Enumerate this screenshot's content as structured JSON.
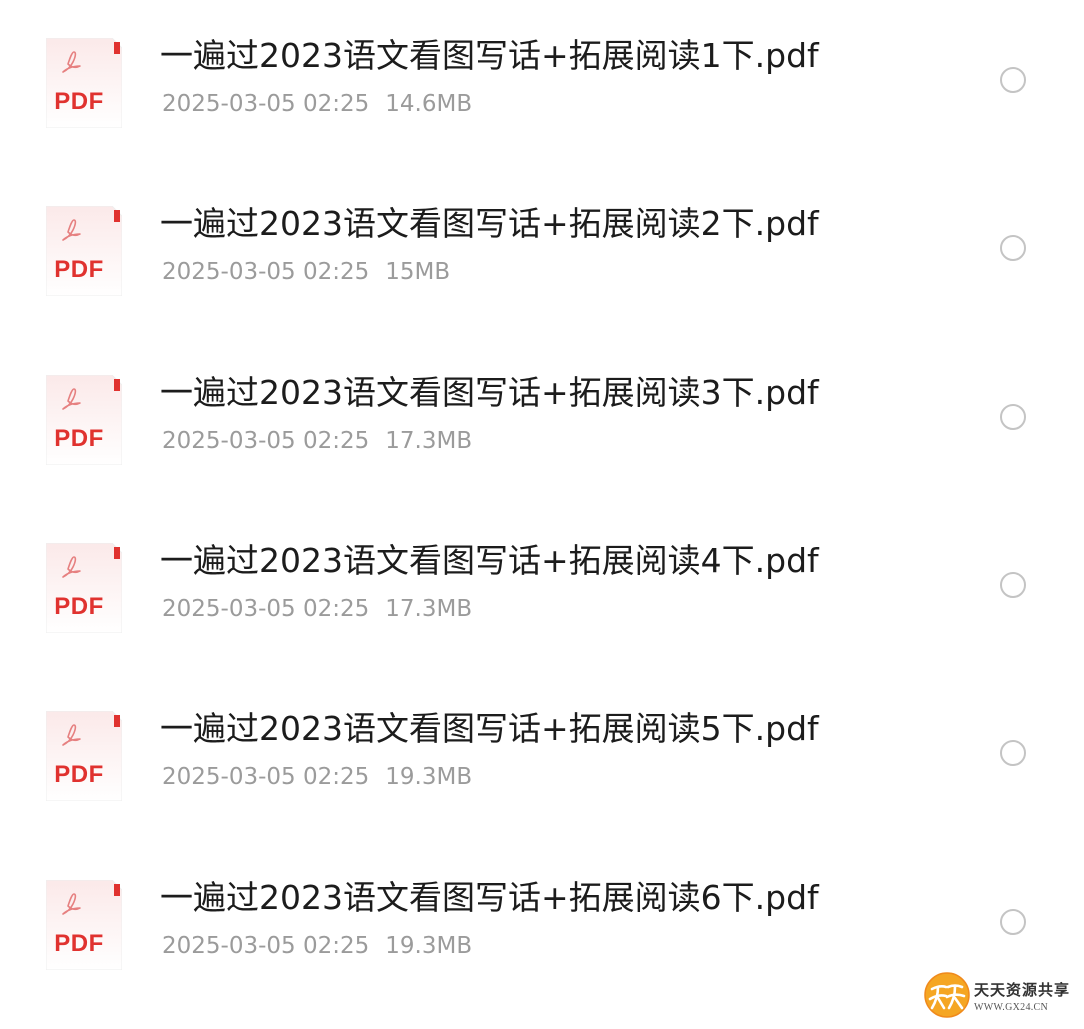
{
  "files": [
    {
      "name": "一遍过2023语文看图写话+拓展阅读1下.pdf",
      "date": "2025-03-05 02:25",
      "size": "14.6MB",
      "icon_label": "PDF",
      "icon": "pdf-file-icon",
      "selected": false
    },
    {
      "name": "一遍过2023语文看图写话+拓展阅读2下.pdf",
      "date": "2025-03-05 02:25",
      "size": "15MB",
      "icon_label": "PDF",
      "icon": "pdf-file-icon",
      "selected": false
    },
    {
      "name": "一遍过2023语文看图写话+拓展阅读3下.pdf",
      "date": "2025-03-05 02:25",
      "size": "17.3MB",
      "icon_label": "PDF",
      "icon": "pdf-file-icon",
      "selected": false
    },
    {
      "name": "一遍过2023语文看图写话+拓展阅读4下.pdf",
      "date": "2025-03-05 02:25",
      "size": "17.3MB",
      "icon_label": "PDF",
      "icon": "pdf-file-icon",
      "selected": false
    },
    {
      "name": "一遍过2023语文看图写话+拓展阅读5下.pdf",
      "date": "2025-03-05 02:25",
      "size": "19.3MB",
      "icon_label": "PDF",
      "icon": "pdf-file-icon",
      "selected": false
    },
    {
      "name": "一遍过2023语文看图写话+拓展阅读6下.pdf",
      "date": "2025-03-05 02:25",
      "size": "19.3MB",
      "icon_label": "PDF",
      "icon": "pdf-file-icon",
      "selected": false
    }
  ],
  "watermark": {
    "title": "天天资源共享",
    "url": "WWW.GX24.CN",
    "logo_text": "天天"
  },
  "colors": {
    "pdf_red": "#e0322f",
    "file_name": "#1c1c1c",
    "meta_gray": "#9b9b9b",
    "radio_border": "#c4c4c4",
    "logo_orange": "#f5a623"
  }
}
